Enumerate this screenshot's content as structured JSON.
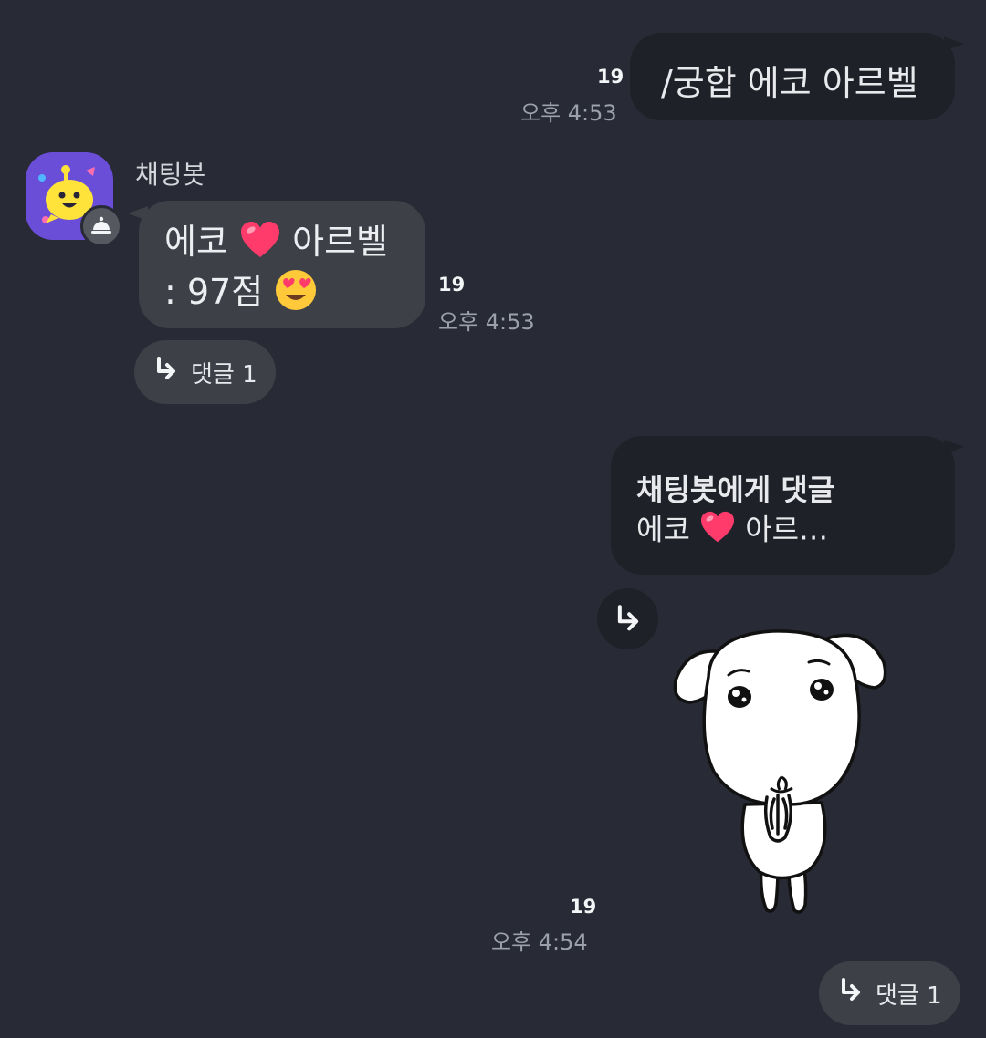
{
  "messages": {
    "out1": {
      "text": "/궁합 에코 아르벨",
      "count": "19",
      "time": "오후 4:53"
    },
    "bot": {
      "name": "채팅봇",
      "line1_a": "에코",
      "line1_b": "아르벨",
      "line2_a": ": 97점",
      "count": "19",
      "time": "오후 4:53",
      "reply_label": "댓글 1"
    },
    "out2": {
      "reply_title": "채팅봇에게 댓글",
      "reply_a": "에코",
      "reply_b": "아르…",
      "count": "19",
      "time": "오후 4:54",
      "reply_label": "댓글 1"
    }
  },
  "colors": {
    "background": "#282b35",
    "bubble_out": "#1f2128",
    "bubble_in": "#3d4047",
    "bot_avatar": "#6a4ed8",
    "bot_face": "#ffe23a",
    "heart": "#ff3b6b"
  },
  "icons": {
    "reply": "reply-arrow-icon",
    "heart": "heart-emoji-icon",
    "love_eyes": "heart-eyes-emoji-icon",
    "bot_badge": "bot-badge-icon",
    "sticker": "puppy-sticker"
  }
}
